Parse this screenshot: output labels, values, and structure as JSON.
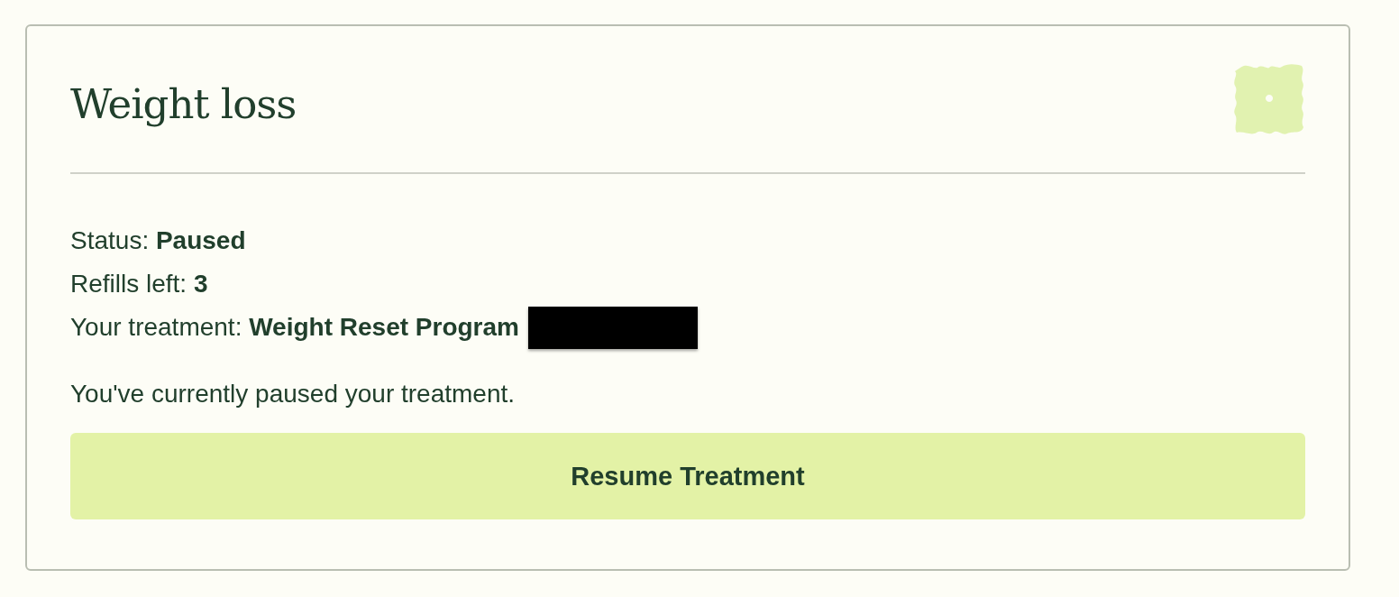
{
  "card": {
    "title": "Weight loss",
    "details": [
      {
        "text": "Status: **Paused**",
        "redacted": false
      },
      {
        "text": "Refills left: **3**",
        "redacted": false
      },
      {
        "text": "Your treatment: **Weight Reset Program**",
        "redacted": true
      }
    ],
    "message": "You've currently paused your treatment.",
    "button": "Resume Treatment"
  }
}
